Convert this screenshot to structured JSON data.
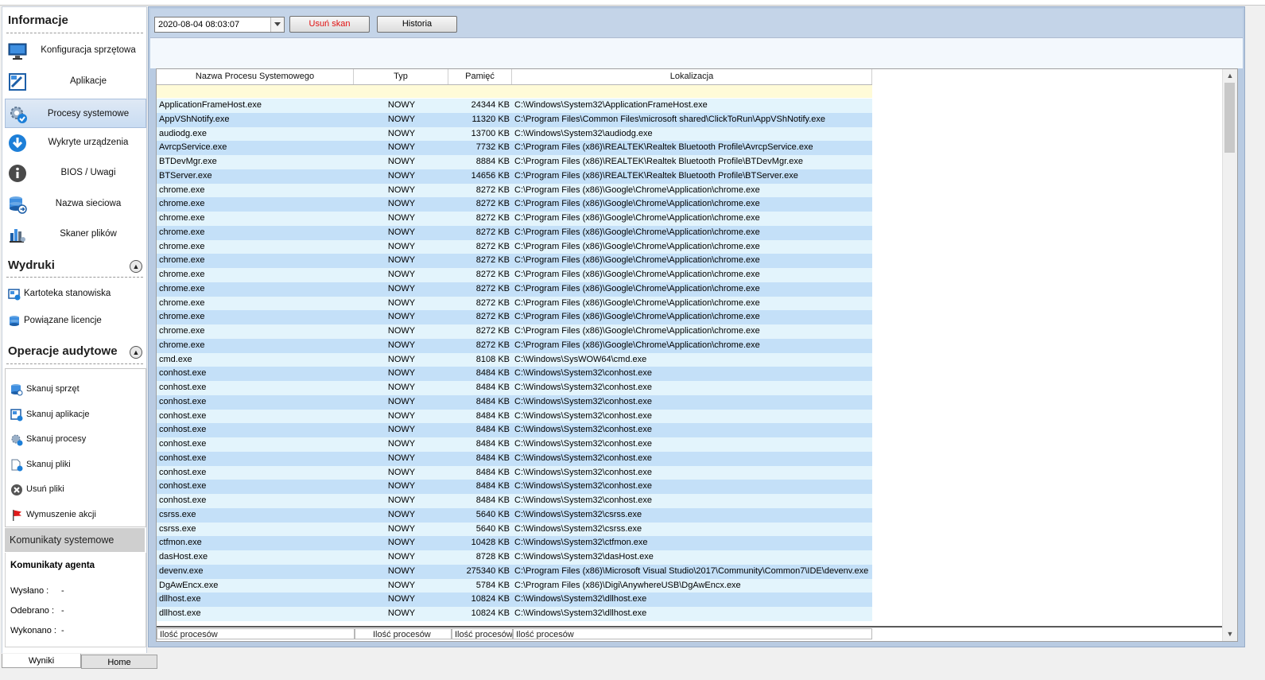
{
  "sidebar": {
    "informacje": {
      "header": "Informacje",
      "items": [
        {
          "label": "Konfiguracja sprzętowa",
          "icon": "monitor-icon"
        },
        {
          "label": "Aplikacje",
          "icon": "application-icon"
        },
        {
          "label": "Procesy systemowe",
          "icon": "process-gear-icon",
          "active": true
        },
        {
          "label": "Wykryte urządzenia",
          "icon": "download-arrow-icon"
        },
        {
          "label": "BIOS / Uwagi",
          "icon": "info-icon"
        },
        {
          "label": "Nazwa sieciowa",
          "icon": "network-database-icon"
        },
        {
          "label": "Skaner plików",
          "icon": "file-scanner-icon"
        }
      ]
    },
    "wydruki": {
      "header": "Wydruki",
      "items": [
        {
          "label": "Kartoteka stanowiska",
          "icon": "workstation-card-icon"
        },
        {
          "label": "Powiązane licencje",
          "icon": "license-stack-icon"
        }
      ]
    },
    "operacje": {
      "header": "Operacje audytowe",
      "items": [
        {
          "label": "Skanuj sprzęt",
          "icon": "scan-hardware-icon"
        },
        {
          "label": "Skanuj aplikacje",
          "icon": "scan-apps-icon"
        },
        {
          "label": "Skanuj procesy",
          "icon": "scan-processes-icon"
        },
        {
          "label": "Skanuj pliki",
          "icon": "scan-files-icon"
        },
        {
          "label": "Usuń pliki",
          "icon": "delete-files-icon"
        },
        {
          "label": "Wymuszenie akcji",
          "icon": "red-flag-icon"
        }
      ]
    },
    "komunikaty": {
      "header": "Komunikaty systemowe",
      "agent_title": "Komunikaty agenta",
      "rows": [
        {
          "label": "Wysłano :",
          "value": "-"
        },
        {
          "label": "Odebrano :",
          "value": "-"
        },
        {
          "label": "Wykonano :",
          "value": "-"
        }
      ]
    }
  },
  "toolbar": {
    "date_value": "2020-08-04 08:03:07",
    "delete_scan_label": "Usuń skan",
    "history_label": "Historia",
    "delete_color": "#e01010"
  },
  "grid": {
    "columns": [
      "Nazwa Procesu Systemowego",
      "Typ",
      "Pamięć",
      "Lokalizacja"
    ],
    "rows": [
      [
        "ApplicationFrameHost.exe",
        "NOWY",
        "24344 KB",
        "C:\\Windows\\System32\\ApplicationFrameHost.exe"
      ],
      [
        "AppVShNotify.exe",
        "NOWY",
        "11320 KB",
        "C:\\Program Files\\Common Files\\microsoft shared\\ClickToRun\\AppVShNotify.exe"
      ],
      [
        "audiodg.exe",
        "NOWY",
        "13700 KB",
        "C:\\Windows\\System32\\audiodg.exe"
      ],
      [
        "AvrcpService.exe",
        "NOWY",
        "7732 KB",
        "C:\\Program Files (x86)\\REALTEK\\Realtek Bluetooth Profile\\AvrcpService.exe"
      ],
      [
        "BTDevMgr.exe",
        "NOWY",
        "8884 KB",
        "C:\\Program Files (x86)\\REALTEK\\Realtek Bluetooth Profile\\BTDevMgr.exe"
      ],
      [
        "BTServer.exe",
        "NOWY",
        "14656 KB",
        "C:\\Program Files (x86)\\REALTEK\\Realtek Bluetooth Profile\\BTServer.exe"
      ],
      [
        "chrome.exe",
        "NOWY",
        "8272 KB",
        "C:\\Program Files (x86)\\Google\\Chrome\\Application\\chrome.exe"
      ],
      [
        "chrome.exe",
        "NOWY",
        "8272 KB",
        "C:\\Program Files (x86)\\Google\\Chrome\\Application\\chrome.exe"
      ],
      [
        "chrome.exe",
        "NOWY",
        "8272 KB",
        "C:\\Program Files (x86)\\Google\\Chrome\\Application\\chrome.exe"
      ],
      [
        "chrome.exe",
        "NOWY",
        "8272 KB",
        "C:\\Program Files (x86)\\Google\\Chrome\\Application\\chrome.exe"
      ],
      [
        "chrome.exe",
        "NOWY",
        "8272 KB",
        "C:\\Program Files (x86)\\Google\\Chrome\\Application\\chrome.exe"
      ],
      [
        "chrome.exe",
        "NOWY",
        "8272 KB",
        "C:\\Program Files (x86)\\Google\\Chrome\\Application\\chrome.exe"
      ],
      [
        "chrome.exe",
        "NOWY",
        "8272 KB",
        "C:\\Program Files (x86)\\Google\\Chrome\\Application\\chrome.exe"
      ],
      [
        "chrome.exe",
        "NOWY",
        "8272 KB",
        "C:\\Program Files (x86)\\Google\\Chrome\\Application\\chrome.exe"
      ],
      [
        "chrome.exe",
        "NOWY",
        "8272 KB",
        "C:\\Program Files (x86)\\Google\\Chrome\\Application\\chrome.exe"
      ],
      [
        "chrome.exe",
        "NOWY",
        "8272 KB",
        "C:\\Program Files (x86)\\Google\\Chrome\\Application\\chrome.exe"
      ],
      [
        "chrome.exe",
        "NOWY",
        "8272 KB",
        "C:\\Program Files (x86)\\Google\\Chrome\\Application\\chrome.exe"
      ],
      [
        "chrome.exe",
        "NOWY",
        "8272 KB",
        "C:\\Program Files (x86)\\Google\\Chrome\\Application\\chrome.exe"
      ],
      [
        "cmd.exe",
        "NOWY",
        "8108 KB",
        "C:\\Windows\\SysWOW64\\cmd.exe"
      ],
      [
        "conhost.exe",
        "NOWY",
        "8484 KB",
        "C:\\Windows\\System32\\conhost.exe"
      ],
      [
        "conhost.exe",
        "NOWY",
        "8484 KB",
        "C:\\Windows\\System32\\conhost.exe"
      ],
      [
        "conhost.exe",
        "NOWY",
        "8484 KB",
        "C:\\Windows\\System32\\conhost.exe"
      ],
      [
        "conhost.exe",
        "NOWY",
        "8484 KB",
        "C:\\Windows\\System32\\conhost.exe"
      ],
      [
        "conhost.exe",
        "NOWY",
        "8484 KB",
        "C:\\Windows\\System32\\conhost.exe"
      ],
      [
        "conhost.exe",
        "NOWY",
        "8484 KB",
        "C:\\Windows\\System32\\conhost.exe"
      ],
      [
        "conhost.exe",
        "NOWY",
        "8484 KB",
        "C:\\Windows\\System32\\conhost.exe"
      ],
      [
        "conhost.exe",
        "NOWY",
        "8484 KB",
        "C:\\Windows\\System32\\conhost.exe"
      ],
      [
        "conhost.exe",
        "NOWY",
        "8484 KB",
        "C:\\Windows\\System32\\conhost.exe"
      ],
      [
        "conhost.exe",
        "NOWY",
        "8484 KB",
        "C:\\Windows\\System32\\conhost.exe"
      ],
      [
        "csrss.exe",
        "NOWY",
        "5640 KB",
        "C:\\Windows\\System32\\csrss.exe"
      ],
      [
        "csrss.exe",
        "NOWY",
        "5640 KB",
        "C:\\Windows\\System32\\csrss.exe"
      ],
      [
        "ctfmon.exe",
        "NOWY",
        "10428 KB",
        "C:\\Windows\\System32\\ctfmon.exe"
      ],
      [
        "dasHost.exe",
        "NOWY",
        "8728 KB",
        "C:\\Windows\\System32\\dasHost.exe"
      ],
      [
        "devenv.exe",
        "NOWY",
        "275340 KB",
        "C:\\Program Files (x86)\\Microsoft Visual Studio\\2017\\Community\\Common7\\IDE\\devenv.exe"
      ],
      [
        "DgAwEncx.exe",
        "NOWY",
        "5784 KB",
        "C:\\Program Files (x86)\\Digi\\AnywhereUSB\\DgAwEncx.exe"
      ],
      [
        "dllhost.exe",
        "NOWY",
        "10824 KB",
        "C:\\Windows\\System32\\dllhost.exe"
      ],
      [
        "dllhost.exe",
        "NOWY",
        "10824 KB",
        "C:\\Windows\\System32\\dllhost.exe"
      ]
    ],
    "footer": [
      "Ilość procesów",
      "Ilość procesów",
      "Ilość procesów",
      "Ilość procesów"
    ],
    "row_colors": {
      "even": "#e3f4fc",
      "odd": "#c4e0f8",
      "filter": "#fffbd8"
    }
  },
  "tabs": [
    {
      "label": "Wyniki",
      "active": true
    },
    {
      "label": "Home",
      "active": false
    }
  ]
}
